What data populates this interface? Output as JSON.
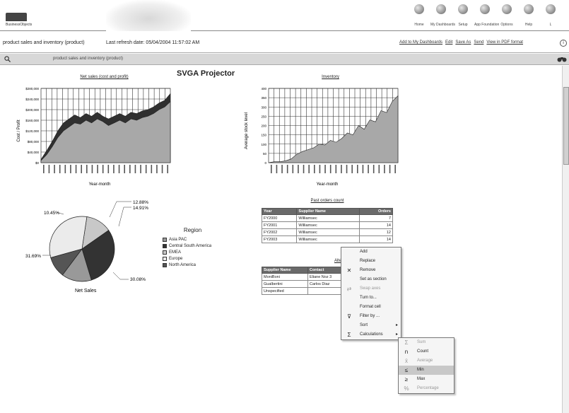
{
  "banner": {
    "logo_text": "BusinessObjects",
    "nav": [
      {
        "label": "Home",
        "icon": "home-icon"
      },
      {
        "label": "My Dashboards",
        "icon": "dashboards-icon"
      },
      {
        "label": "Setup",
        "icon": "setup-icon"
      },
      {
        "label": "App Foundation",
        "icon": "app-foundation-icon"
      },
      {
        "label": "Options",
        "icon": "options-icon"
      },
      {
        "label": "Help",
        "icon": "help-icon"
      },
      {
        "label": "L",
        "icon": "logout-icon"
      }
    ]
  },
  "infobar": {
    "report_name": "product sales and inventory (product)",
    "refresh": "Last refresh date: 05/04/2004 11:57:02 AM",
    "links": [
      "Add to My Dashboards",
      "Edit",
      "Save As",
      "Send",
      "View in PDF format"
    ]
  },
  "toolbar": {
    "title": "product sales and inventory (product)"
  },
  "doc_title": "SVGA Projector",
  "net_sales_chart": {
    "title": "Net sales (cost and profit)",
    "ylabel": "Cost / Profit",
    "xlabel": "Year-month",
    "yticks": [
      "$280,000",
      "$240,000",
      "$200,000",
      "$160,000",
      "$120,000",
      "$80,000",
      "$40,000",
      "$0"
    ]
  },
  "inventory_chart": {
    "title": "Inventory",
    "ylabel": "Average stock level",
    "xlabel": "Year-month",
    "yticks": [
      "400",
      "350",
      "300",
      "250",
      "200",
      "150",
      "100",
      "50",
      "0"
    ]
  },
  "pie": {
    "caption": "Net Sales",
    "legend_title": "Region",
    "labels": [
      "12.88%",
      "14.91%",
      "30.08%",
      "31.69%",
      "10.45%"
    ],
    "legend": [
      {
        "name": "Asia PAC",
        "color": "#999999"
      },
      {
        "name": "Central South America",
        "color": "#333333"
      },
      {
        "name": "EMEA",
        "color": "#c8c8c8"
      },
      {
        "name": "Europe",
        "color": "#ebebeb"
      },
      {
        "name": "North America",
        "color": "#555555"
      }
    ]
  },
  "chart_data": [
    {
      "type": "area",
      "title": "Net sales (cost and profit)",
      "xlabel": "Year-month",
      "ylabel": "Cost / Profit",
      "ylim": [
        0,
        280000
      ],
      "series": [
        {
          "name": "Cost",
          "values": [
            8000,
            30000,
            60000,
            95000,
            120000,
            135000,
            150000,
            145000,
            160000,
            150000,
            165000,
            155000,
            140000,
            150000,
            160000,
            150000,
            165000,
            160000,
            170000,
            175000,
            185000,
            200000,
            210000,
            230000
          ]
        },
        {
          "name": "Profit",
          "values": [
            12000,
            45000,
            80000,
            120000,
            150000,
            165000,
            180000,
            170000,
            185000,
            175000,
            190000,
            175000,
            165000,
            175000,
            185000,
            175000,
            190000,
            185000,
            195000,
            200000,
            210000,
            225000,
            235000,
            260000
          ]
        }
      ]
    },
    {
      "type": "area",
      "title": "Inventory",
      "xlabel": "Year-month",
      "ylabel": "Average stock level",
      "ylim": [
        0,
        400
      ],
      "values": [
        0,
        5,
        5,
        10,
        20,
        45,
        60,
        70,
        80,
        100,
        95,
        120,
        110,
        130,
        160,
        150,
        200,
        180,
        230,
        220,
        280,
        270,
        330,
        360
      ]
    },
    {
      "type": "pie",
      "title": "Net Sales",
      "categories": [
        "Asia PAC",
        "Central South America",
        "EMEA",
        "Europe",
        "North America"
      ],
      "values": [
        14.91,
        30.08,
        12.88,
        31.69,
        10.45
      ]
    }
  ],
  "past_orders": {
    "title": "Past orders count",
    "headers": [
      "Year",
      "Supplier Name",
      "Orders"
    ],
    "rows": [
      [
        "FY2000",
        "Williamsec",
        "7"
      ],
      [
        "FY2001",
        "Williamsec",
        "14"
      ],
      [
        "FY2002",
        "Williamsec",
        "12"
      ],
      [
        "FY2003",
        "Williamsec",
        "14"
      ]
    ]
  },
  "alternate": {
    "title": "Alternate su",
    "headers": [
      "Supplier Name",
      "Contact"
    ],
    "rows": [
      [
        "MoniBoni",
        "Eliane Noz 3"
      ],
      [
        "Gualbertini",
        "Carlos Diaz"
      ],
      [
        "Unspecified",
        ""
      ]
    ]
  },
  "context_menu": [
    {
      "label": "Add",
      "icon": ""
    },
    {
      "label": "Replace",
      "icon": ""
    },
    {
      "label": "Remove",
      "icon": "remove-icon"
    },
    {
      "label": "Set as section",
      "icon": ""
    },
    {
      "label": "Swap axes",
      "icon": "swap-icon",
      "disabled": true
    },
    {
      "label": "Turn to...",
      "icon": ""
    },
    {
      "label": "Format cell",
      "icon": ""
    },
    {
      "label": "Filter by ...",
      "icon": "filter-icon"
    },
    {
      "label": "Sort",
      "icon": "",
      "submenu": true
    },
    {
      "label": "Calculations",
      "icon": "sum-icon",
      "submenu": true
    }
  ],
  "calc_submenu": [
    {
      "label": "Sum",
      "icon": "Σ",
      "disabled": true
    },
    {
      "label": "Count",
      "icon": "n",
      "disabled": false
    },
    {
      "label": "Average",
      "icon": "x̄",
      "disabled": true
    },
    {
      "label": "Min",
      "icon": "≤",
      "disabled": false,
      "highlight": true
    },
    {
      "label": "Max",
      "icon": "≥",
      "disabled": false
    },
    {
      "label": "Percentage",
      "icon": "%",
      "disabled": true
    }
  ]
}
